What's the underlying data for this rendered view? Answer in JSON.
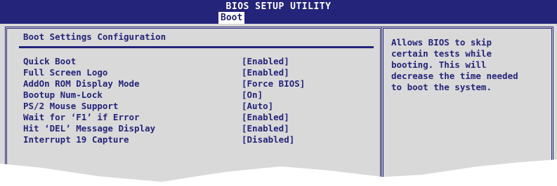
{
  "title": "BIOS SETUP UTILITY",
  "active_tab": "Boot",
  "section_title": "Boot Settings Configuration",
  "settings": [
    {
      "label": "Quick Boot",
      "value": "[Enabled]"
    },
    {
      "label": "Full Screen Logo",
      "value": "[Enabled]"
    },
    {
      "label": "AddOn ROM Display Mode",
      "value": "[Force BIOS]"
    },
    {
      "label": "Bootup Num-Lock",
      "value": "[On]"
    },
    {
      "label": "PS/2 Mouse Support",
      "value": "[Auto]"
    },
    {
      "label": "Wait for ‘F1’ if Error",
      "value": "[Enabled]"
    },
    {
      "label": "Hit ‘DEL’ Message Display",
      "value": "[Enabled]"
    },
    {
      "label": "Interrupt 19 Capture",
      "value": "[Disabled]"
    }
  ],
  "help_text": "Allows BIOS to skip\ncertain tests while\nbooting. This will\ndecrease the time needed\nto boot the system.",
  "colors": {
    "title_bar": "#24247a",
    "panel_bg": "#d9d9d9",
    "text": "#24247a"
  }
}
